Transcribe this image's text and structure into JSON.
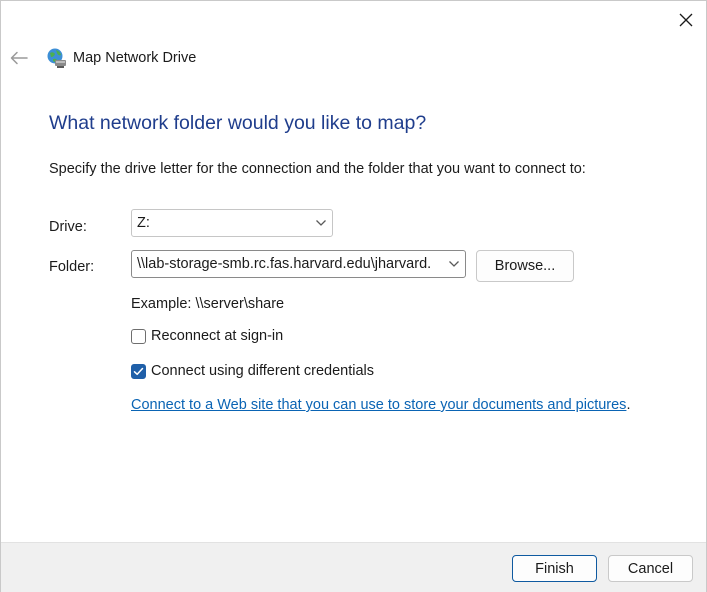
{
  "window": {
    "title": "Map Network Drive",
    "close_icon": "close-icon",
    "back_icon": "back-arrow-icon",
    "app_icon": "network-drive-icon"
  },
  "main": {
    "heading": "What network folder would you like to map?",
    "instructions": "Specify the drive letter for the connection and the folder that you want to connect to:",
    "drive_label": "Drive:",
    "drive_value": "Z:",
    "folder_label": "Folder:",
    "folder_value": "\\\\lab-storage-smb.rc.fas.harvard.edu\\jharvard.",
    "browse_label": "Browse...",
    "example": "Example: \\\\server\\share",
    "reconnect_label": "Reconnect at sign-in",
    "reconnect_checked": false,
    "credentials_label": "Connect using different credentials",
    "credentials_checked": true,
    "link_text": "Connect to a Web site that you can use to store your documents and pictures",
    "link_suffix": "."
  },
  "footer": {
    "finish_label": "Finish",
    "cancel_label": "Cancel"
  },
  "colors": {
    "heading": "#1f3d8c",
    "link": "#0a64b4",
    "checkbox_checked": "#1f5fa8",
    "footer_bg": "#f0f0f0"
  }
}
